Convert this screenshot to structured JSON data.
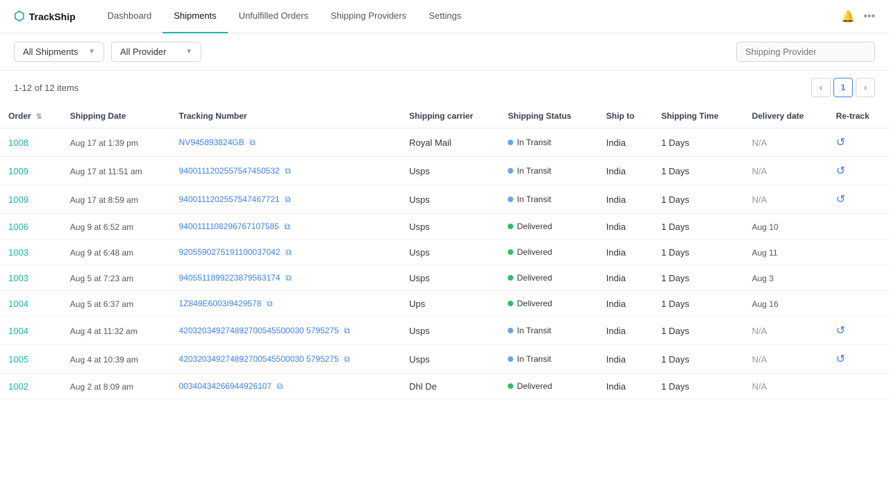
{
  "app": {
    "name": "TrackShip"
  },
  "nav": {
    "tabs": [
      {
        "id": "dashboard",
        "label": "Dashboard",
        "active": false
      },
      {
        "id": "shipments",
        "label": "Shipments",
        "active": true
      },
      {
        "id": "unfulfilled",
        "label": "Unfulfilled Orders",
        "active": false
      },
      {
        "id": "providers",
        "label": "Shipping Providers",
        "active": false
      },
      {
        "id": "settings",
        "label": "Settings",
        "active": false
      }
    ]
  },
  "toolbar": {
    "shipments_filter": "All Shipments",
    "provider_filter": "All Provider",
    "search_placeholder": "Shipping Provider"
  },
  "table": {
    "pagination": {
      "info": "1-12 of 12 items",
      "current_page": 1
    },
    "columns": [
      "Order",
      "Shipping Date",
      "Tracking Number",
      "Shipping carrier",
      "Shipping Status",
      "Ship to",
      "Shipping Time",
      "Delivery date",
      "Re-track"
    ],
    "rows": [
      {
        "order": "1008",
        "shipping_date": "Aug 17 at 1:39 pm",
        "tracking_number": "NV945893824GB",
        "carrier": "Royal Mail",
        "status": "In Transit",
        "status_type": "in-transit",
        "ship_to": "India",
        "shipping_time": "1 Days",
        "delivery_date": "N/A",
        "has_retrack": true
      },
      {
        "order": "1009",
        "shipping_date": "Aug 17 at 11:51 am",
        "tracking_number": "9400111202557547450532",
        "carrier": "Usps",
        "status": "In Transit",
        "status_type": "in-transit",
        "ship_to": "India",
        "shipping_time": "1 Days",
        "delivery_date": "N/A",
        "has_retrack": true
      },
      {
        "order": "1009",
        "shipping_date": "Aug 17 at 8:59 am",
        "tracking_number": "9400111202557547467721",
        "carrier": "Usps",
        "status": "In Transit",
        "status_type": "in-transit",
        "ship_to": "India",
        "shipping_time": "1 Days",
        "delivery_date": "N/A",
        "has_retrack": true
      },
      {
        "order": "1006",
        "shipping_date": "Aug 9 at 6:52 am",
        "tracking_number": "9400111108296767107585",
        "carrier": "Usps",
        "status": "Delivered",
        "status_type": "delivered",
        "ship_to": "India",
        "shipping_time": "1 Days",
        "delivery_date": "Aug 10",
        "has_retrack": false
      },
      {
        "order": "1003",
        "shipping_date": "Aug 9 at 6:48 am",
        "tracking_number": "9205590275191100037042",
        "carrier": "Usps",
        "status": "Delivered",
        "status_type": "delivered",
        "ship_to": "India",
        "shipping_time": "1 Days",
        "delivery_date": "Aug 11",
        "has_retrack": false
      },
      {
        "order": "1003",
        "shipping_date": "Aug 5 at 7:23 am",
        "tracking_number": "9405511899223879563174",
        "carrier": "Usps",
        "status": "Delivered",
        "status_type": "delivered",
        "ship_to": "India",
        "shipping_time": "1 Days",
        "delivery_date": "Aug 3",
        "has_retrack": false
      },
      {
        "order": "1004",
        "shipping_date": "Aug 5 at 6:37 am",
        "tracking_number": "1Z849E6003I9429578",
        "carrier": "Ups",
        "status": "Delivered",
        "status_type": "delivered",
        "ship_to": "India",
        "shipping_time": "1 Days",
        "delivery_date": "Aug 16",
        "has_retrack": false
      },
      {
        "order": "1004",
        "shipping_date": "Aug 4 at 11:32 am",
        "tracking_number": "420320349274892700545500030 5795275",
        "carrier": "Usps",
        "status": "In Transit",
        "status_type": "in-transit",
        "ship_to": "India",
        "shipping_time": "1 Days",
        "delivery_date": "N/A",
        "has_retrack": true
      },
      {
        "order": "1005",
        "shipping_date": "Aug 4 at 10:39 am",
        "tracking_number": "420320349274892700545500030 5795275",
        "carrier": "Usps",
        "status": "In Transit",
        "status_type": "in-transit",
        "ship_to": "India",
        "shipping_time": "1 Days",
        "delivery_date": "N/A",
        "has_retrack": true
      },
      {
        "order": "1002",
        "shipping_date": "Aug 2 at 8:09 am",
        "tracking_number": "00340434266944926107",
        "carrier": "Dhl De",
        "status": "Delivered",
        "status_type": "delivered",
        "ship_to": "India",
        "shipping_time": "1 Days",
        "delivery_date": "N/A",
        "has_retrack": false
      }
    ]
  }
}
